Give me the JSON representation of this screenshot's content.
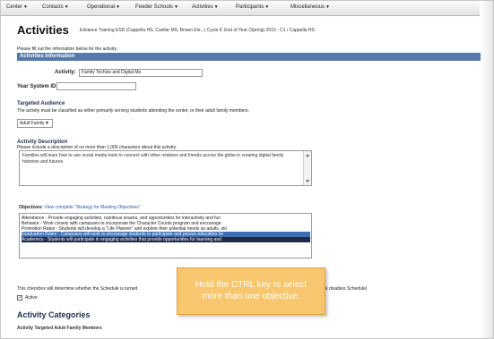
{
  "nav": {
    "items": [
      "Center",
      "Contacts",
      "Operational",
      "Feeder Schools",
      "Activities",
      "Participants",
      "Miscellaneous"
    ]
  },
  "header": {
    "title": "Activities",
    "subtitle": "Edvance Training ESD (Cappella HS, Cuellar MS, Brown Ele...) Cycle 6: End of Year (Spring) 2010 - C1 / Cappella HS"
  },
  "instructions": "Please fill out the information below for the activity.",
  "section": {
    "title": "Activities Information"
  },
  "form": {
    "activity_label": "Activity:",
    "activity_value": "Family Techies and Digital Me",
    "year_system_id_label": "Year System ID:",
    "year_system_id_value": ""
  },
  "audience": {
    "heading": "Targeted Audience",
    "description": "The activity must be classified as either primarily serving students attending the center, or their adult family members.",
    "selected": "Adult Family"
  },
  "activity_description": {
    "heading": "Activity Description",
    "help": "Please include a description of no more than 1,000 characters about this activity.",
    "text": "Families will learn how to use social media tools to connect with other relatives and friends across the globe in creating digital family histories and futures."
  },
  "objectives": {
    "label": "Objectives:",
    "link_text": "View complete \"Strategy for Meeting Objectives\"",
    "options": [
      "Attendance - Provide engaging activities, nutritious snacks, and opportunities for interactivity and fun",
      "Behavior - Work closely with campuses to incorporate the Character Counts program and encourage",
      "Promotion Rates - Students will develop a \"Life Planner\" and explore their potential needs as adults, ski",
      "Graduation Rates - Campuses will work to encourage students to participate and pursue education be",
      "Academics - Students will participate in engaging activities that provide opportunities for learning and"
    ]
  },
  "schedule": {
    "help": "This checkbox will determine whether the Schedule is turned",
    "help_tail": "eck disables Schedule)",
    "checkbox_label": "Active",
    "checked_mark": "✓"
  },
  "categories": {
    "heading": "Activity Categories",
    "sub": "Activity Targeted Adult Family Members"
  },
  "tooltip": {
    "line1": "Hold the CTRL key to select",
    "line2": "more than one objective."
  }
}
